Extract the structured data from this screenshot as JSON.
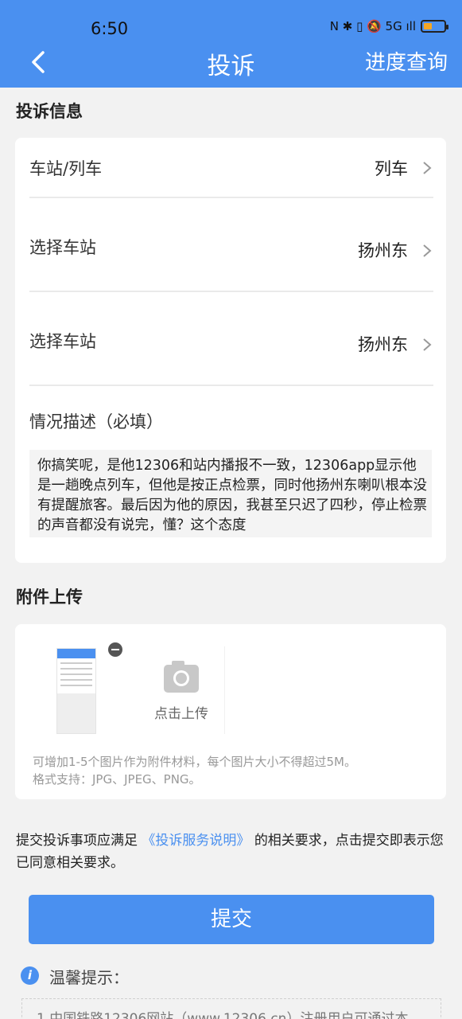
{
  "status_bar": {
    "time": "6:50",
    "icons_text": "N ✱ ▯ 🔕 5G ıll"
  },
  "header": {
    "title": "投诉",
    "action": "进度查询"
  },
  "complaint_section": {
    "title": "投诉信息",
    "rows": [
      {
        "label": "车站/列车",
        "value": "列车"
      },
      {
        "label": "选择车站",
        "value": "扬州东"
      },
      {
        "label": "选择车站",
        "value": "扬州东"
      }
    ],
    "description_label": "情况描述（必填）",
    "description_text": "你搞笑呢，是他12306和站内播报不一致，12306app显示他是一趟晚点列车，但他是按正点检票，同时他扬州东喇叭根本没有提醒旅客。最后因为他的原因，我甚至只迟了四秒，停止检票的声音都没有说完，懂？这个态度"
  },
  "attachment_section": {
    "title": "附件上传",
    "upload_label": "点击上传",
    "hint_line1": "可增加1-5个图片作为附件材料，每个图片大小不得超过5M。",
    "hint_line2": "格式支持：JPG、JPEG、PNG。"
  },
  "notice": {
    "prefix": "提交投诉事项应满足",
    "link": "《投诉服务说明》",
    "suffix": "的相关要求，点击提交即表示您已同意相关要求。"
  },
  "submit_label": "提交",
  "tips": {
    "icon": "i",
    "title": "温馨提示：",
    "line1": "1.中国铁路12306网站（www.12306.cn）注册用户可通过本"
  },
  "colors": {
    "brand": "#4a90f0",
    "background": "#f2f2f2"
  }
}
